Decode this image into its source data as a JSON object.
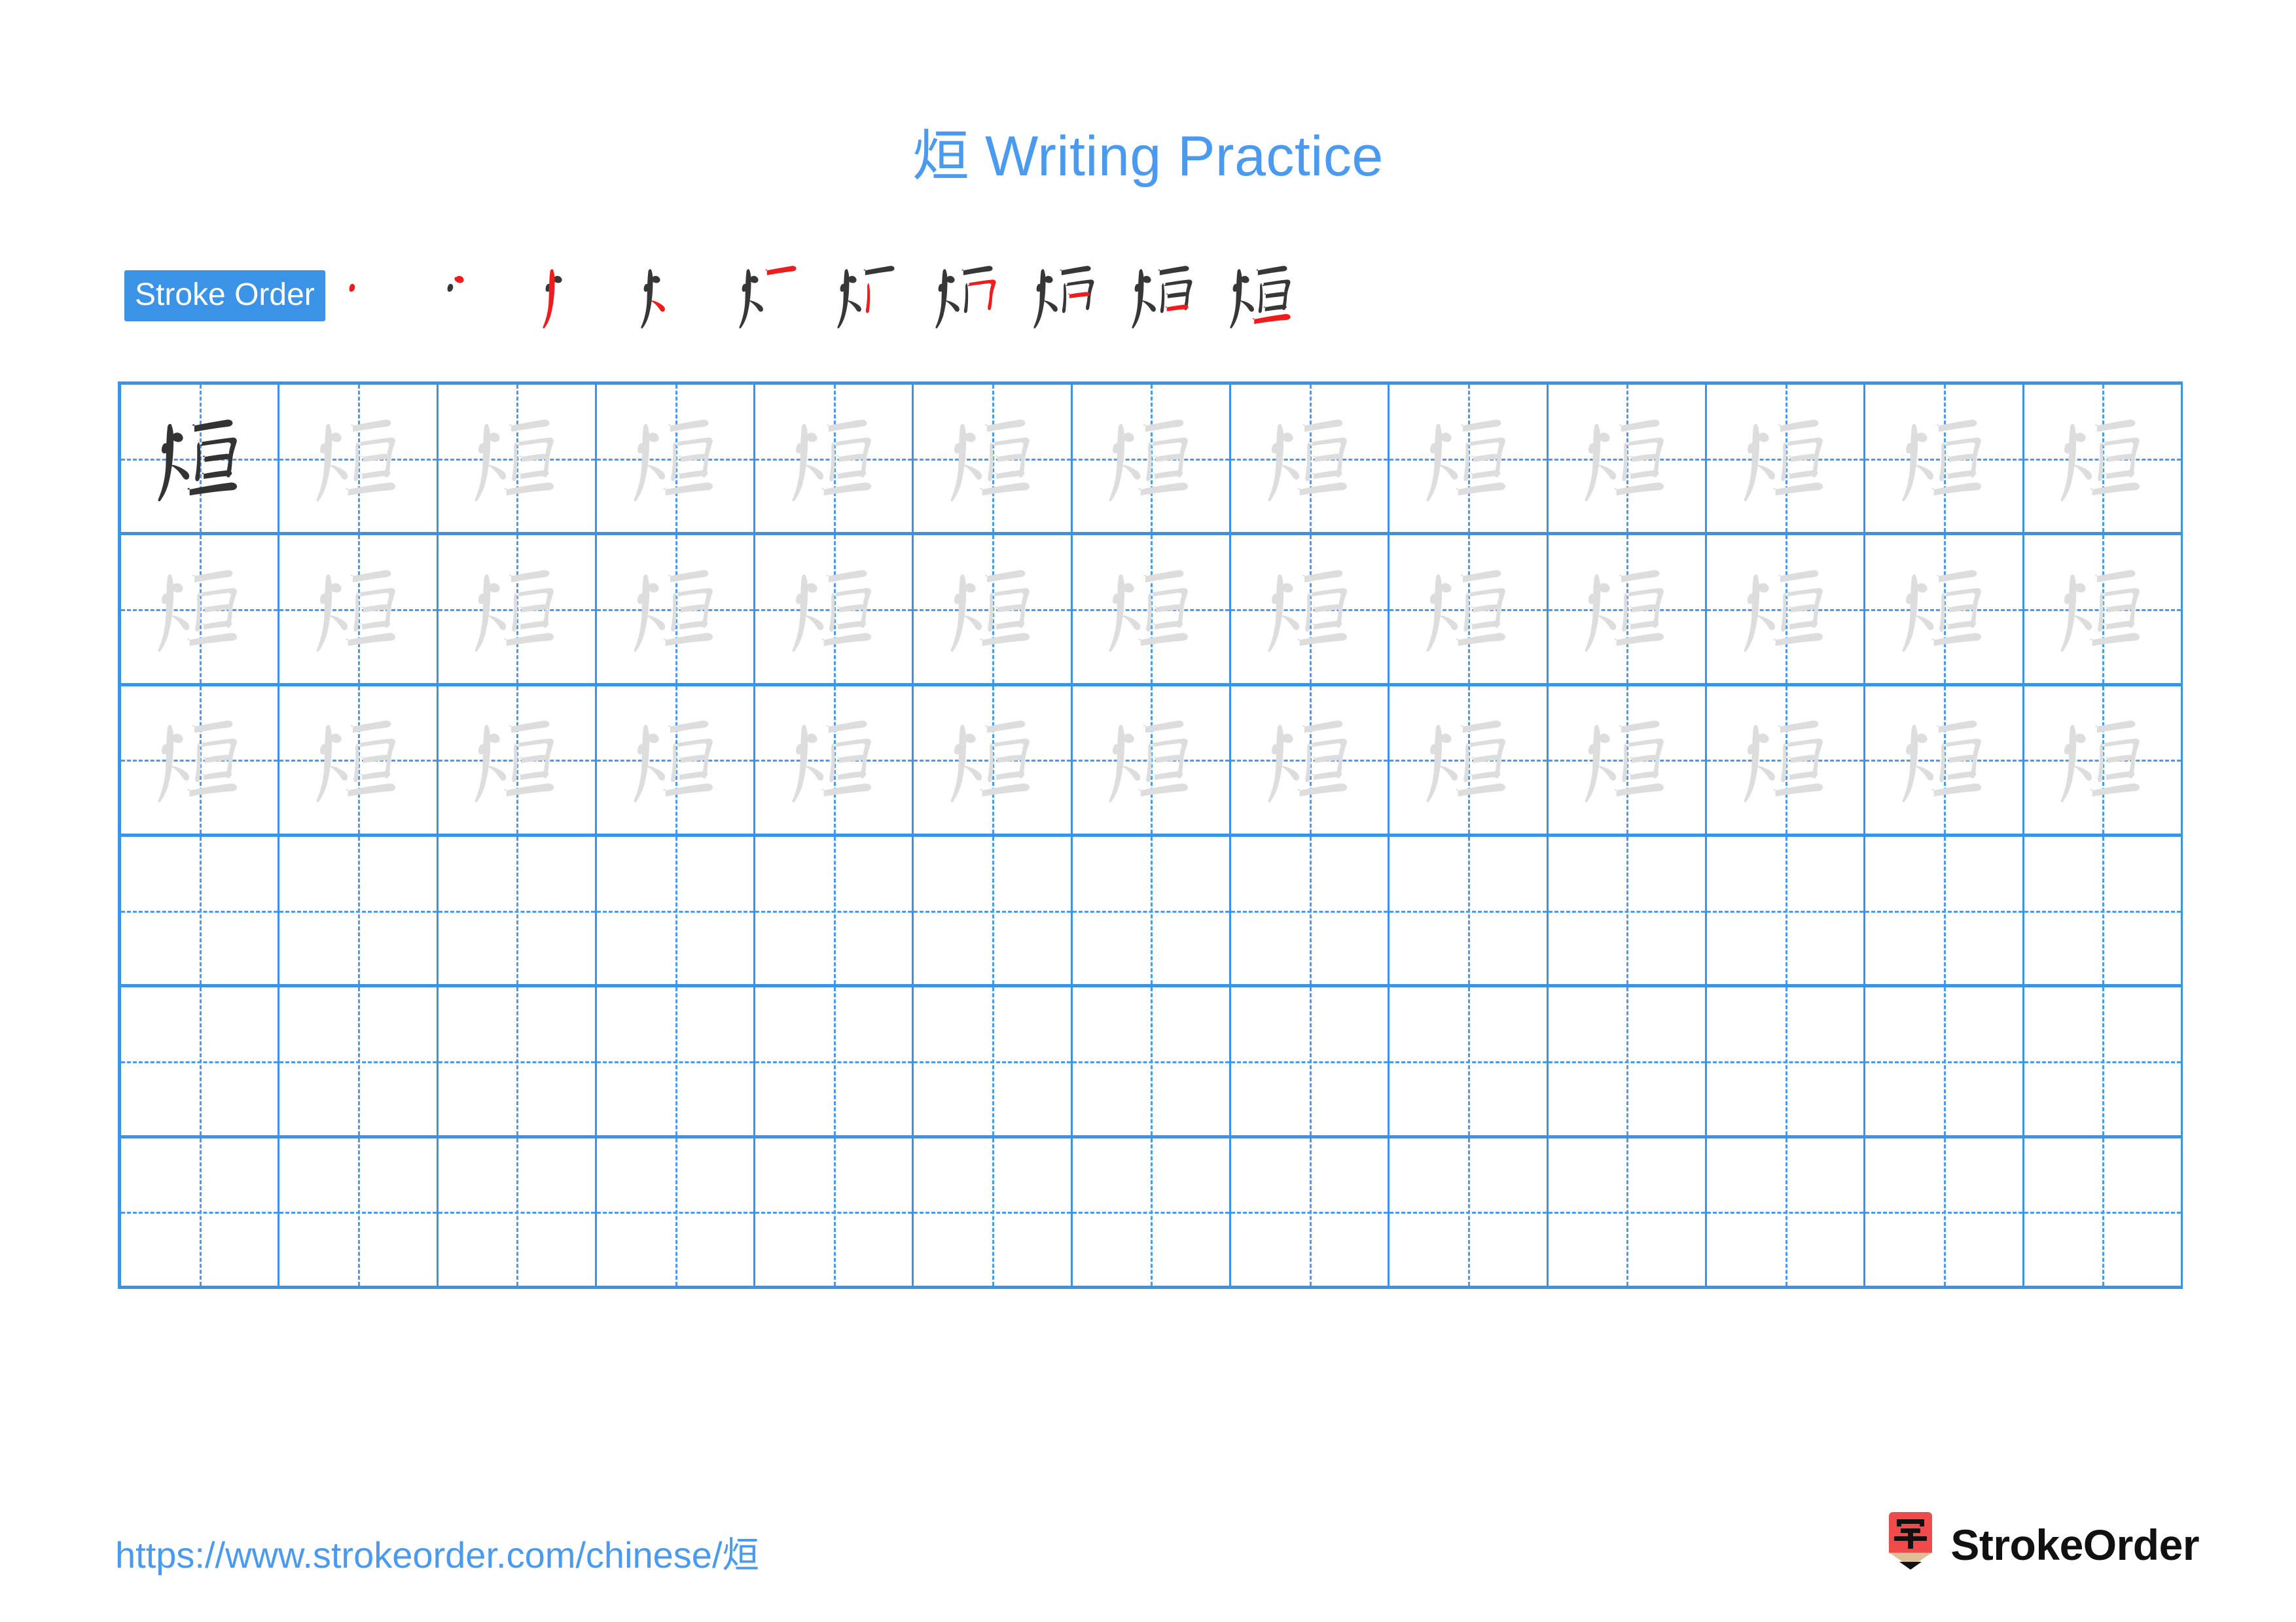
{
  "page": {
    "character": "烜",
    "title": "烜 Writing Practice",
    "background_color": "#ffffff",
    "accent_color": "#4a9af0",
    "badge_color": "#3b93e8",
    "new_stroke_color": "#ee1c1c",
    "done_stroke_color": "#373737",
    "trace_char_color": "#dddddd",
    "model_char_color": "#333333"
  },
  "stroke_order": {
    "badge_label": "Stroke Order",
    "total_strokes": 10,
    "steps": [
      {
        "index": 1,
        "strokes_drawn": 1,
        "new_stroke_name": "dian"
      },
      {
        "index": 2,
        "strokes_drawn": 2,
        "new_stroke_name": "dian"
      },
      {
        "index": 3,
        "strokes_drawn": 3,
        "new_stroke_name": "pie"
      },
      {
        "index": 4,
        "strokes_drawn": 4,
        "new_stroke_name": "na"
      },
      {
        "index": 5,
        "strokes_drawn": 5,
        "new_stroke_name": "heng"
      },
      {
        "index": 6,
        "strokes_drawn": 6,
        "new_stroke_name": "shu"
      },
      {
        "index": 7,
        "strokes_drawn": 7,
        "new_stroke_name": "hengzhe"
      },
      {
        "index": 8,
        "strokes_drawn": 8,
        "new_stroke_name": "heng"
      },
      {
        "index": 9,
        "strokes_drawn": 9,
        "new_stroke_name": "heng"
      },
      {
        "index": 10,
        "strokes_drawn": 10,
        "new_stroke_name": "heng"
      }
    ]
  },
  "practice_grid": {
    "columns": 13,
    "rows": 6,
    "rows_data": [
      {
        "row": 1,
        "cells": [
          "model",
          "trace",
          "trace",
          "trace",
          "trace",
          "trace",
          "trace",
          "trace",
          "trace",
          "trace",
          "trace",
          "trace",
          "trace"
        ]
      },
      {
        "row": 2,
        "cells": [
          "trace",
          "trace",
          "trace",
          "trace",
          "trace",
          "trace",
          "trace",
          "trace",
          "trace",
          "trace",
          "trace",
          "trace",
          "trace"
        ]
      },
      {
        "row": 3,
        "cells": [
          "trace",
          "trace",
          "trace",
          "trace",
          "trace",
          "trace",
          "trace",
          "trace",
          "trace",
          "trace",
          "trace",
          "trace",
          "trace"
        ]
      },
      {
        "row": 4,
        "cells": [
          "empty",
          "empty",
          "empty",
          "empty",
          "empty",
          "empty",
          "empty",
          "empty",
          "empty",
          "empty",
          "empty",
          "empty",
          "empty"
        ]
      },
      {
        "row": 5,
        "cells": [
          "empty",
          "empty",
          "empty",
          "empty",
          "empty",
          "empty",
          "empty",
          "empty",
          "empty",
          "empty",
          "empty",
          "empty",
          "empty"
        ]
      },
      {
        "row": 6,
        "cells": [
          "empty",
          "empty",
          "empty",
          "empty",
          "empty",
          "empty",
          "empty",
          "empty",
          "empty",
          "empty",
          "empty",
          "empty",
          "empty"
        ]
      }
    ]
  },
  "footer": {
    "url": "https://www.strokeorder.com/chinese/烜",
    "brand_name": "StrokeOrder",
    "logo_char": "字",
    "logo_body_color": "#f04a4a",
    "logo_wood_color": "#e0bf96",
    "logo_tip_color": "#111111"
  }
}
